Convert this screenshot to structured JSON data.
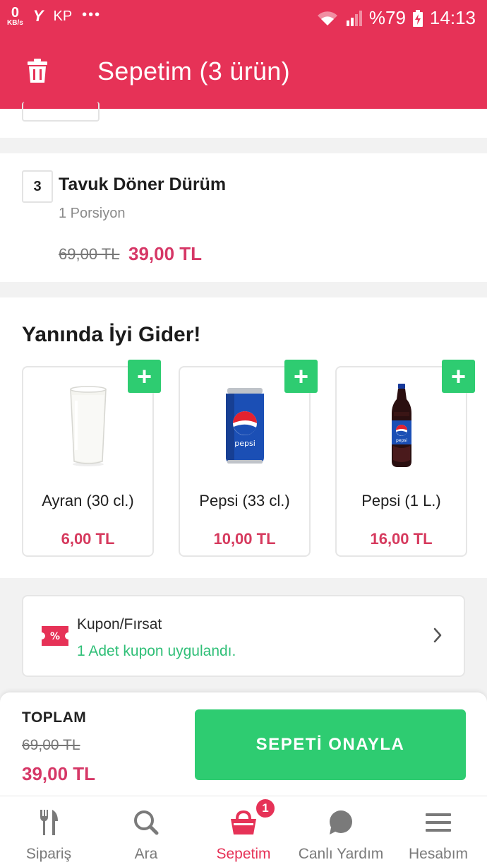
{
  "status_bar": {
    "speed_value": "0",
    "speed_unit": "KB/s",
    "carrier_icon": "Y",
    "carrier_text": "KP",
    "more": "•••",
    "battery": "%79",
    "time": "14:13"
  },
  "header": {
    "title": "Sepetim (3 ürün)"
  },
  "cart_item": {
    "quantity": "3",
    "name": "Tavuk Döner Dürüm",
    "portion": "1 Porsiyon",
    "old_price": "69,00 TL",
    "new_price": "39,00 TL"
  },
  "extras": {
    "title": "Yanında İyi Gider!",
    "plus_symbol": "+",
    "products": [
      {
        "name": "Ayran (30 cl.)",
        "price": "6,00 TL",
        "image": "ayran-glass"
      },
      {
        "name": "Pepsi (33 cl.)",
        "price": "10,00 TL",
        "image": "pepsi-can"
      },
      {
        "name": "Pepsi (1 L.)",
        "price": "16,00 TL",
        "image": "pepsi-bottle"
      }
    ]
  },
  "coupon": {
    "title": "Kupon/Fırsat",
    "subtitle": "1 Adet kupon uygulandı.",
    "icon_text": "%"
  },
  "summary": {
    "label": "TOPLAM",
    "old_total": "69,00 TL",
    "new_total": "39,00 TL",
    "confirm_label": "SEPETİ ONAYLA"
  },
  "bottom_nav": {
    "items": [
      {
        "label": "Sipariş",
        "icon": "fork-knife-icon"
      },
      {
        "label": "Ara",
        "icon": "search-icon"
      },
      {
        "label": "Sepetim",
        "icon": "basket-icon",
        "badge": "1",
        "active": true
      },
      {
        "label": "Canlı Yardım",
        "icon": "chat-bubble-icon"
      },
      {
        "label": "Hesabım",
        "icon": "menu-icon"
      }
    ]
  },
  "colors": {
    "brand": "#e63257",
    "price": "#d63867",
    "green": "#2ecc71"
  }
}
